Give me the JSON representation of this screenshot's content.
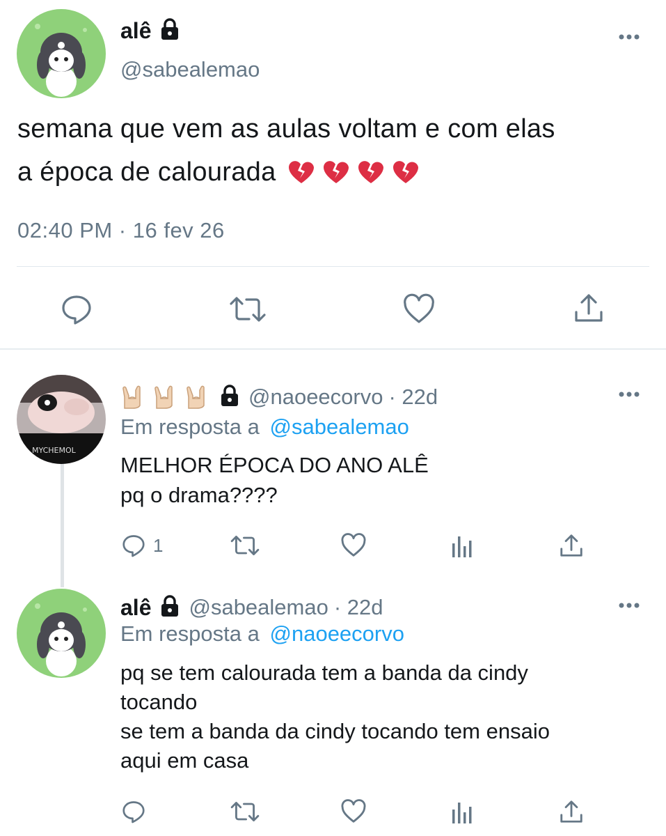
{
  "main_tweet": {
    "name": "alê",
    "handle": "@sabealemao",
    "text_line1": "semana que vem as aulas voltam e com elas",
    "text_line2": "a época de calourada",
    "emoji": [
      "broken-heart",
      "broken-heart",
      "broken-heart",
      "broken-heart"
    ],
    "timestamp": "02:40 PM · 16 fev 26"
  },
  "reply1": {
    "handle": "@naoeecorvo",
    "time": "· 22d",
    "name_emoji": [
      "sign-of-horns",
      "sign-of-horns",
      "sign-of-horns"
    ],
    "reply_prefix": "Em resposta a",
    "reply_to": "@sabealemao",
    "text_line1": "MELHOR ÉPOCA DO ANO ALÊ",
    "text_line2": "pq o drama????",
    "reply_count": "1"
  },
  "reply2": {
    "name": "alê",
    "handle": "@sabealemao",
    "time": "· 22d",
    "reply_prefix": "Em resposta a",
    "reply_to": "@naoeecorvo",
    "text_line1": "pq se tem calourada tem a banda da cindy",
    "text_line2": "tocando",
    "text_line3": "se tem a banda da cindy tocando tem ensaio",
    "text_line4": "aqui em casa"
  },
  "colors": {
    "text": "#14171a",
    "secondary": "#657786",
    "link": "#1da1f2",
    "divider": "#e1e8ed"
  }
}
